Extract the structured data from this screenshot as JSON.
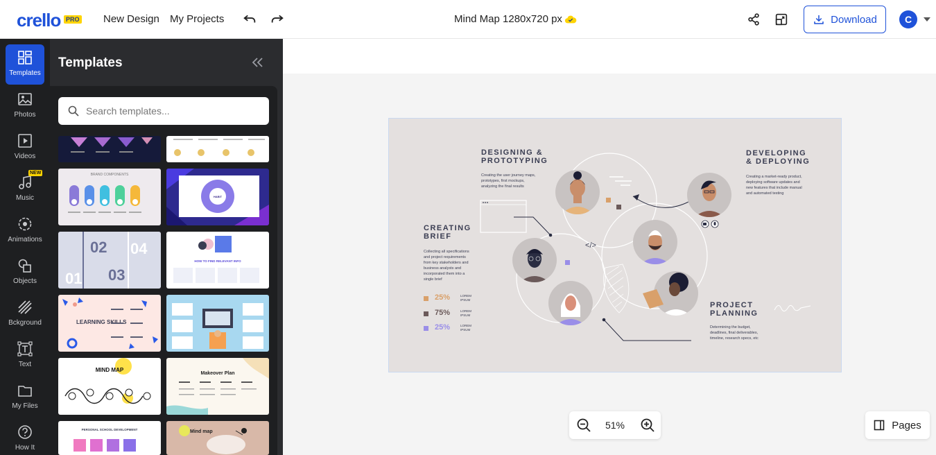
{
  "app": {
    "logo": "crello",
    "logo_badge": "PRO",
    "nav": [
      "New Design",
      "My Projects"
    ],
    "doc_title": "Mind Map 1280x720 px",
    "download_label": "Download",
    "avatar_letter": "C"
  },
  "rail": [
    {
      "label": "Templates",
      "icon": "templates-icon"
    },
    {
      "label": "Photos",
      "icon": "photos-icon"
    },
    {
      "label": "Videos",
      "icon": "videos-icon"
    },
    {
      "label": "Music",
      "icon": "music-icon",
      "badge": "NEW"
    },
    {
      "label": "Animations",
      "icon": "animations-icon"
    },
    {
      "label": "Objects",
      "icon": "objects-icon"
    },
    {
      "label": "Bckground",
      "icon": "background-icon"
    },
    {
      "label": "Text",
      "icon": "text-icon"
    },
    {
      "label": "My Files",
      "icon": "folder-icon"
    },
    {
      "label": "How It",
      "icon": "help-icon"
    }
  ],
  "panel": {
    "title": "Templates",
    "search_placeholder": "Search templates...",
    "thumbs": {
      "mind_map_title": "MIND MAP",
      "makeover_title": "Makeover Plan",
      "learning_title": "LEARNING SKILLS",
      "personal_title": "PERSONAL SCHOOL DEVELOPMENT",
      "mindmap2_title": "Mind map",
      "brand_title": "BRAND COMPONENTS",
      "relevant_title": "HOW TO FIND RELEVANT INFO"
    }
  },
  "artboard": {
    "designing_title": "DESIGNING &\nPROTOTYPING",
    "designing_body": "Creating the user journey maps,\nprototypes, first mockups,\nanalyzing the final results",
    "developing_title": "DEVELOPING\n& DEPLOYING",
    "developing_body": "Creating a market-ready product,\ndeploying software updates and\nnew features that include manual\nand automated testing",
    "brief_title": "CREATING\nBRIEF",
    "brief_body": "Collecting all specifications\nand project requirements\nfrom key stakeholders and\nbusiness analysts and\nincorporated them into a\nsingle brief",
    "planning_title": "PROJECT\nPLANNING",
    "planning_body": "Determining the budget,\ndeadlines, final deliverables,\ntimeline, research specs, etc",
    "stats": [
      {
        "value": "25%",
        "color": "#d9a06a",
        "note": "LOREM\nIPSUM"
      },
      {
        "value": "75%",
        "color": "#6b5a5a",
        "note": "LOREM\nIPSUM"
      },
      {
        "value": "25%",
        "color": "#9a8ee8",
        "note": "LOREM\nIPSUM"
      }
    ],
    "code_symbol": "</>"
  },
  "zoom": {
    "value": "51%"
  },
  "pages_label": "Pages"
}
